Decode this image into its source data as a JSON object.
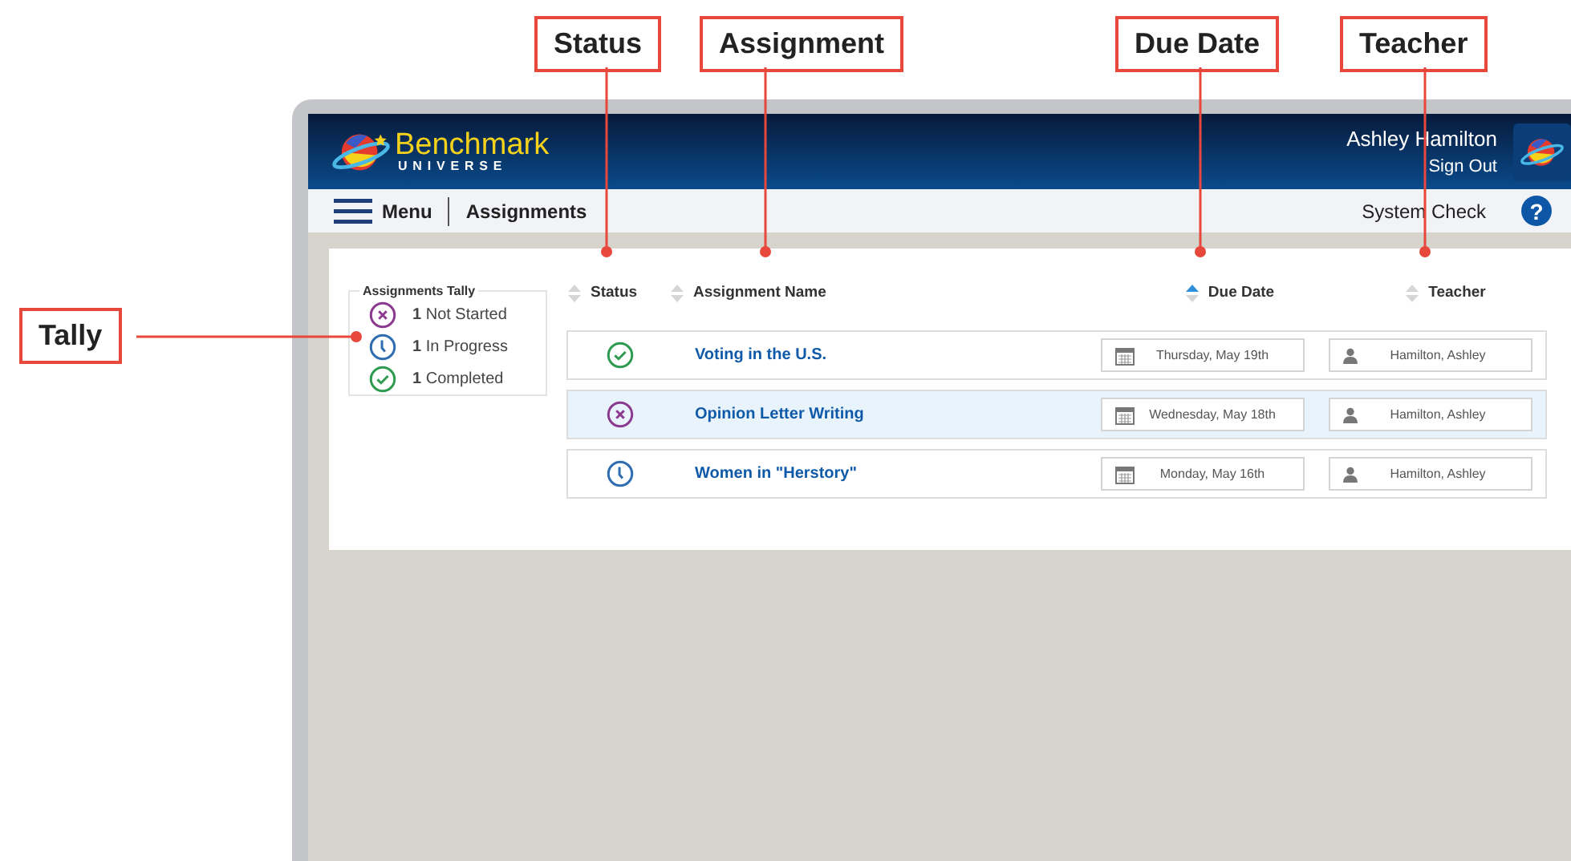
{
  "callouts": [
    {
      "label": "Status"
    },
    {
      "label": "Assignment"
    },
    {
      "label": "Due Date"
    },
    {
      "label": "Teacher"
    },
    {
      "label": "Tally"
    }
  ],
  "header": {
    "brand": "Benchmark",
    "brand_sub": "UNIVERSE",
    "user": "Ashley Hamilton",
    "sign_out": "Sign Out"
  },
  "nav": {
    "menu": "Menu",
    "section": "Assignments",
    "system_check": "System Check",
    "help": "?"
  },
  "tally": {
    "title": "Assignments Tally",
    "items": [
      {
        "kind": "not_started",
        "count": "1",
        "label": "Not Started"
      },
      {
        "kind": "in_progress",
        "count": "1",
        "label": "In Progress"
      },
      {
        "kind": "completed",
        "count": "1",
        "label": "Completed"
      }
    ]
  },
  "columns": [
    {
      "label": "Status",
      "sorted": false
    },
    {
      "label": "Assignment Name",
      "sorted": false
    },
    {
      "label": "Due Date",
      "sorted": true
    },
    {
      "label": "Teacher",
      "sorted": false
    }
  ],
  "rows": [
    {
      "kind": "completed",
      "name": "Voting in the U.S.",
      "due": "Thursday, May 19th",
      "teacher": "Hamilton, Ashley",
      "selected": false
    },
    {
      "kind": "not_started",
      "name": "Opinion Letter Writing",
      "due": "Wednesday, May 18th",
      "teacher": "Hamilton, Ashley",
      "selected": true
    },
    {
      "kind": "in_progress",
      "name": "Women in \"Herstory\"",
      "due": "Monday, May 16th",
      "teacher": "Hamilton, Ashley",
      "selected": false
    }
  ]
}
